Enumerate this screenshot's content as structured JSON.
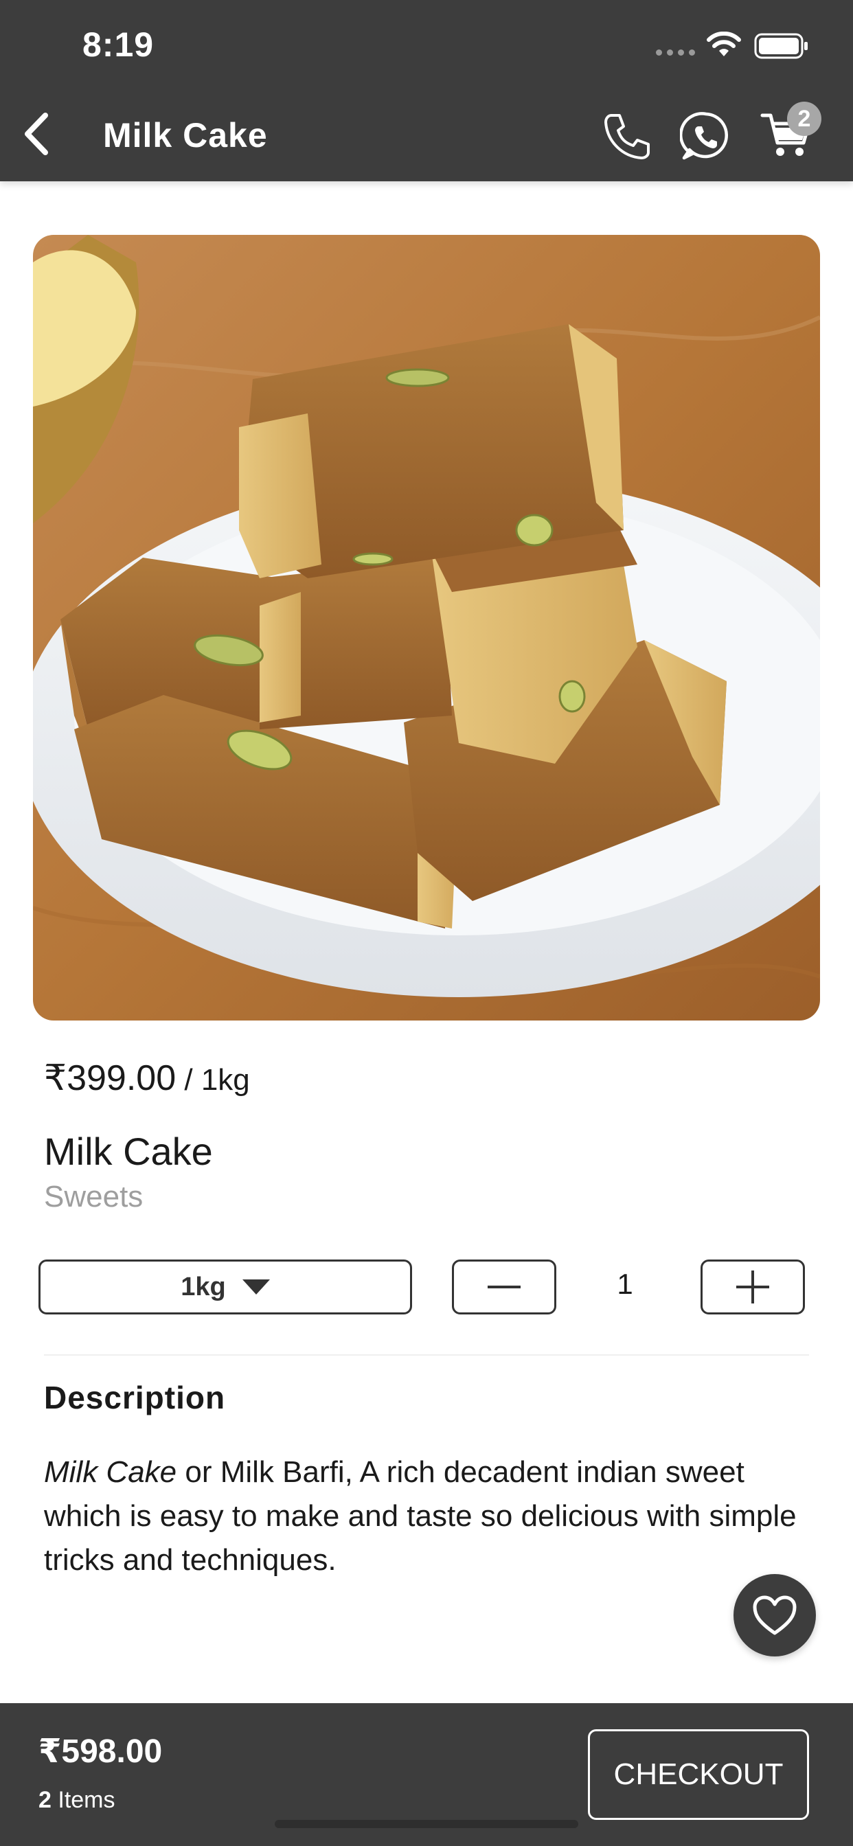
{
  "status_bar": {
    "time": "8:19"
  },
  "header": {
    "title": "Milk Cake",
    "cart_count": "2"
  },
  "product": {
    "price": "₹399.00",
    "price_unit": " / 1kg",
    "name": "Milk Cake",
    "category": "Sweets",
    "selected_weight": "1kg",
    "quantity": "1"
  },
  "description": {
    "heading": "Description",
    "body_italic": "Milk Cake",
    "body_rest": " or Milk Barfi, A rich decadent indian sweet which is easy to make and taste so delicious with simple tricks and techniques."
  },
  "footer": {
    "total": "₹598.00",
    "items_count": "2",
    "items_label": " Items",
    "checkout_label": "CHECKOUT"
  },
  "colors": {
    "bar": "#3d3d3d",
    "muted_text": "#9e9e9e",
    "badge": "#a7a7a7"
  },
  "icons": [
    "back-arrow-icon",
    "phone-icon",
    "whatsapp-icon",
    "cart-icon",
    "chevron-down-icon",
    "minus-icon",
    "plus-icon",
    "heart-icon",
    "wifi-icon",
    "battery-icon"
  ]
}
